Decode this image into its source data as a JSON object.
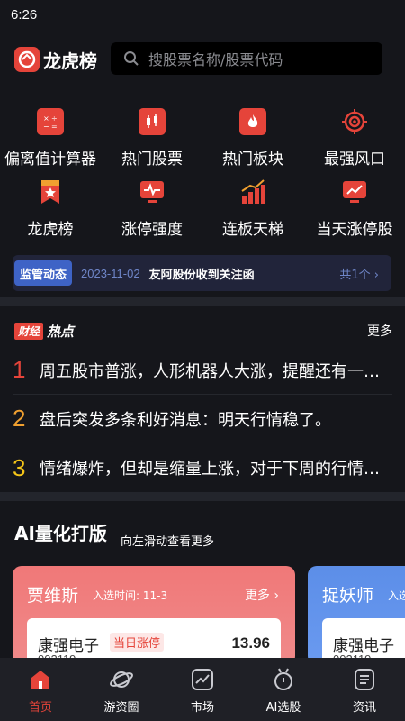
{
  "status_bar": {
    "time": "6:26"
  },
  "header": {
    "app_name": "龙虎榜",
    "search_placeholder": "搜股票名称/股票代码"
  },
  "tools": [
    {
      "label": "偏离值计算器",
      "icon": "calculator-icon"
    },
    {
      "label": "热门股票",
      "icon": "candlestick-icon"
    },
    {
      "label": "热门板块",
      "icon": "flame-icon"
    },
    {
      "label": "最强风口",
      "icon": "target-icon"
    },
    {
      "label": "龙虎榜",
      "icon": "bookmark-star-icon"
    },
    {
      "label": "涨停强度",
      "icon": "monitor-pulse-icon"
    },
    {
      "label": "连板天梯",
      "icon": "ladder-chart-icon"
    },
    {
      "label": "当天涨停股",
      "icon": "monitor-trend-icon"
    }
  ],
  "notice": {
    "badge": "监管动态",
    "date": "2023-11-02",
    "title": "友阿股份收到关注函",
    "count": "共1个"
  },
  "hot": {
    "badge": "财经",
    "word": "热点",
    "more": "更多",
    "items": [
      {
        "rank": "1",
        "text": "周五股市普涨，人形机器人大涨，提醒还有一个大板块要注意"
      },
      {
        "rank": "2",
        "text": "盘后突发多条利好消息：明天行情稳了。"
      },
      {
        "rank": "3",
        "text": "情绪爆炸，但却是缩量上涨，对于下周的行情我们该如何应对"
      }
    ]
  },
  "ai": {
    "title": "AI量化打版",
    "subtitle": "向左滑动查看更多",
    "cards": [
      {
        "name": "贾维斯",
        "time": "入选时间: 11-3",
        "more": "更多",
        "stock_name": "康强电子",
        "stock_tag": "当日涨停",
        "stock_price": "13.96",
        "stock_code": "002119"
      },
      {
        "name": "捉妖师",
        "time": "入选",
        "stock_name": "康强电子",
        "stock_code": "002119"
      }
    ]
  },
  "tabbar": [
    {
      "label": "首页",
      "icon": "home-icon",
      "active": true
    },
    {
      "label": "游资圈",
      "icon": "planet-icon",
      "active": false
    },
    {
      "label": "市场",
      "icon": "chart-icon",
      "active": false
    },
    {
      "label": "AI选股",
      "icon": "robot-icon",
      "active": false
    },
    {
      "label": "资讯",
      "icon": "news-icon",
      "active": false
    }
  ],
  "colors": {
    "accent": "#e5443a",
    "background": "#15161b",
    "rank1": "#e5443a",
    "rank2": "#f0a030",
    "rank3": "#f5c518"
  }
}
